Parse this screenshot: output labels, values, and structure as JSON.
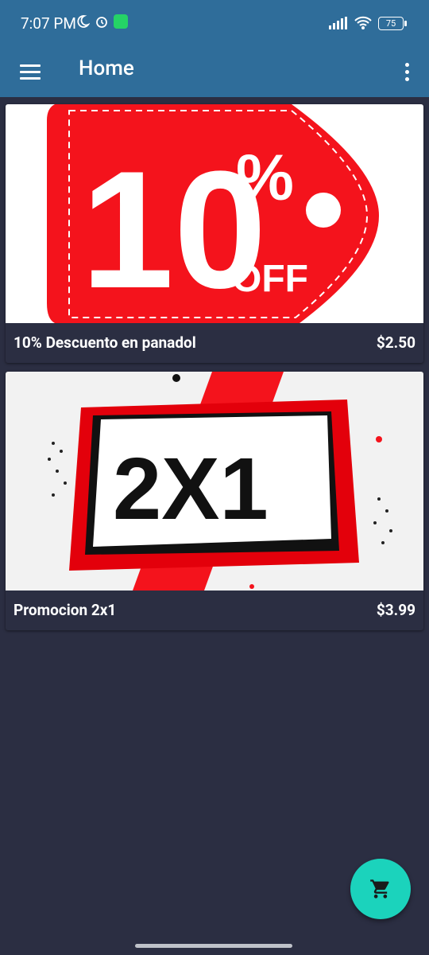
{
  "status_bar": {
    "time": "7:07 PM",
    "battery": "75"
  },
  "app": {
    "title": "Home"
  },
  "products": [
    {
      "name": "10% Descuento en panadol",
      "price": "$2.50",
      "image_text": [
        "10",
        "%",
        "OFF"
      ]
    },
    {
      "name": "Promocion 2x1",
      "price": "$3.99",
      "image_text": [
        "2X1"
      ]
    }
  ],
  "icons": {
    "menu": "hamburger-menu-icon",
    "more": "more-vert-icon",
    "cart": "shopping-cart-icon"
  },
  "colors": {
    "appbar": "#2f6d9a",
    "background": "#2b2e42",
    "fab": "#1bd3bc",
    "promo_red": "#f4131c"
  }
}
